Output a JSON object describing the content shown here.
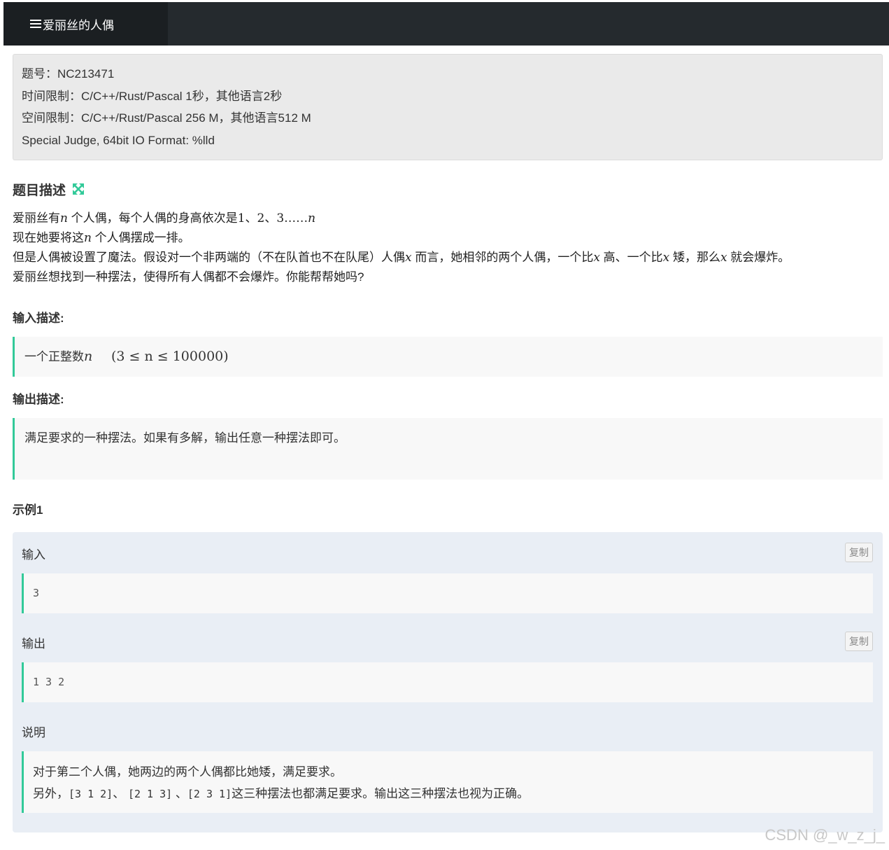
{
  "header": {
    "tab_icon": "list-icon",
    "tab_title": "爱丽丝的人偶"
  },
  "info": {
    "problem_id": "题号：NC213471",
    "time_limit": "时间限制：C/C++/Rust/Pascal 1秒，其他语言2秒",
    "memory_limit": "空间限制：C/C++/Rust/Pascal 256 M，其他语言512 M",
    "judge": "Special Judge, 64bit IO Format: %lld"
  },
  "description": {
    "title": "题目描述",
    "expand_icon": "expand-arrows-icon",
    "l1_a": "爱丽丝有",
    "n": "n",
    "l1_b": " 个人偶，每个人偶的身高依次是",
    "l1_seq": "1、2、3……",
    "l2_a": "现在她要将这",
    "l2_b": " 个人偶摆成一排。",
    "l3_a": "但是人偶被设置了魔法。假设对一个非两端的（不在队首也不在队尾）人偶",
    "x": "x",
    "l3_b": " 而言，她相邻的两个人偶，一个比",
    "l3_c": " 高、一个比",
    "l3_d": " 矮，那么",
    "l3_e": " 就会爆炸。",
    "l4": "爱丽丝想找到一种摆法，使得所有人偶都不会爆炸。你能帮帮她吗?"
  },
  "input_desc": {
    "title": "输入描述:",
    "text": "一个正整数",
    "constraint": "(3 ≤ n ≤ 100000)"
  },
  "output_desc": {
    "title": "输出描述:",
    "text": "满足要求的一种摆法。如果有多解，输出任意一种摆法即可。"
  },
  "example": {
    "title": "示例1",
    "input_label": "输入",
    "input_value": "3",
    "output_label": "输出",
    "output_value": "1 3 2",
    "copy_label": "复制",
    "note_label": "说明",
    "note_line1": "对于第二个人偶，她两边的两个人偶都比她矮，满足要求。",
    "note_line2_a": "另外，",
    "note_line2_code1": "[3 1 2]",
    "note_line2_b": "、 ",
    "note_line2_code2": "[2 1 3]",
    "note_line2_c": " 、",
    "note_line2_code3": "[2 3 1]",
    "note_line2_d": "这三种摆法也都满足要求。输出这三种摆法也视为正确。"
  },
  "watermark": "CSDN @_w_z_j_",
  "colors": {
    "accent": "#32ca99",
    "header_bg": "#252a2e"
  }
}
